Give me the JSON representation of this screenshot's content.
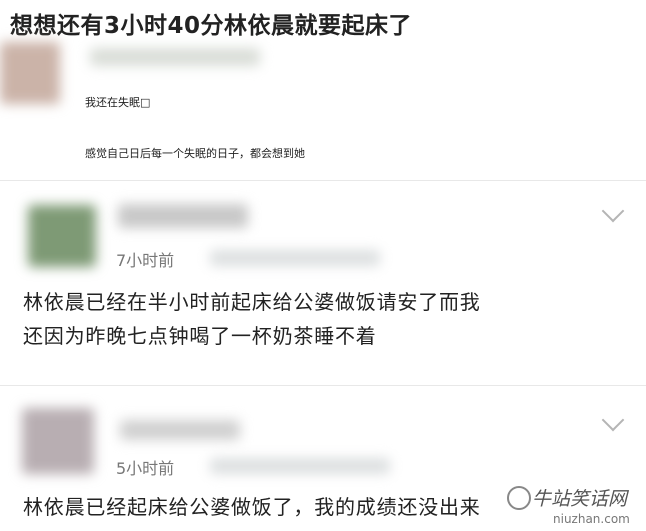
{
  "headline": "想想还有3小时40分林依晨就要起床了",
  "post": {
    "line1": "我还在失眠□",
    "line2": "感觉自己日后每一个失眠的日子，都会想到她"
  },
  "comments": [
    {
      "time": "7小时前",
      "text_line1": "林依晨已经在半小时前起床给公婆做饭请安了而我",
      "text_line2": "还因为昨晚七点钟喝了一杯奶茶睡不着"
    },
    {
      "time": "5小时前",
      "text_line1": "林依晨已经起床给公婆做饭了，我的成绩还没出来"
    }
  ],
  "watermark": {
    "name": "牛站笑话网",
    "url": "niuzhan.com"
  },
  "colors": {
    "text": "#222222",
    "muted": "#777777",
    "chevron": "#b5b5b5"
  },
  "icons": [
    "avatar",
    "chevron-down-icon",
    "watermark-logo"
  ]
}
